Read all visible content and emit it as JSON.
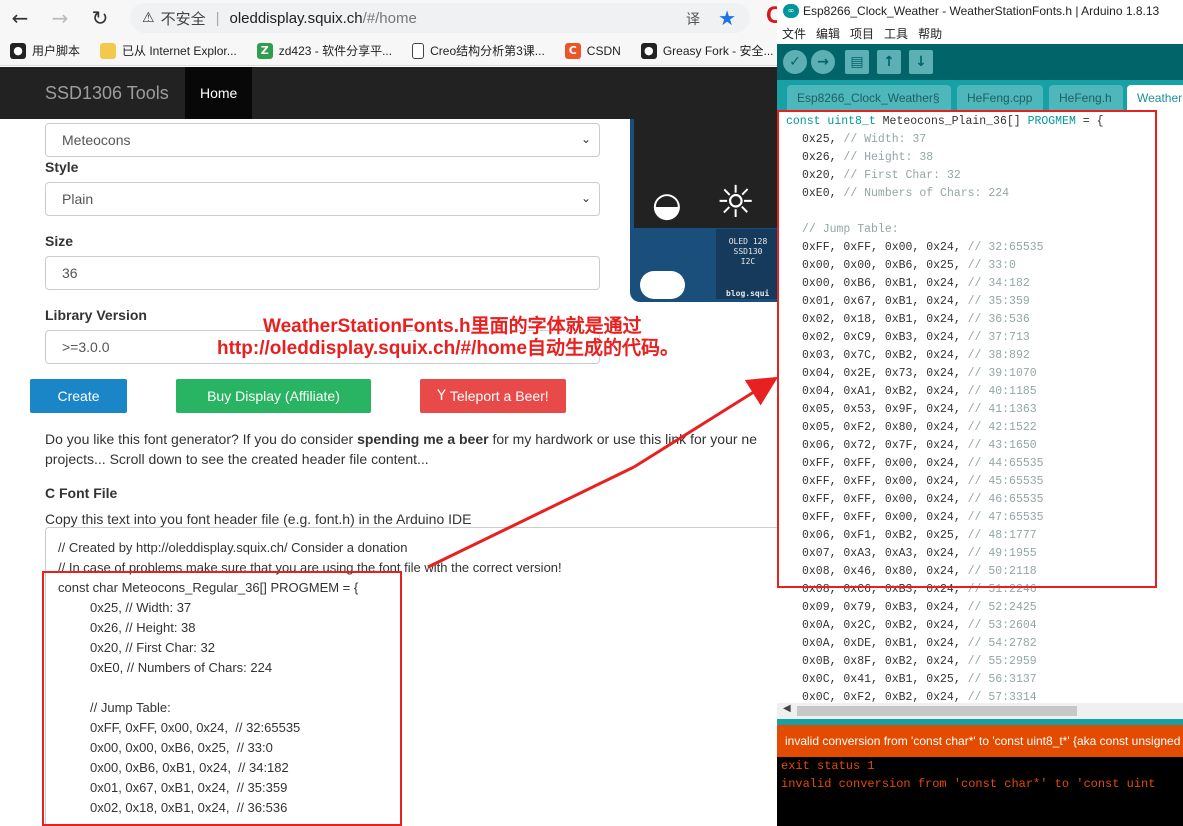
{
  "browser": {
    "security_label": "不安全",
    "url_host": "oleddisplay.squix.ch",
    "url_path": "/#/home",
    "bookmarks": [
      {
        "label": "用户脚本"
      },
      {
        "label": "已从 Internet Explor..."
      },
      {
        "label": "zd423 - 软件分享平..."
      },
      {
        "label": "Creo结构分析第3课..."
      },
      {
        "label": "CSDN"
      },
      {
        "label": "Greasy Fork - 安全..."
      }
    ]
  },
  "site": {
    "brand": "SSD1306 Tools",
    "nav_home": "Home",
    "font_family_value": "Meteocons",
    "style_label": "Style",
    "style_value": "Plain",
    "size_label": "Size",
    "size_value": "36",
    "library_label": "Library Version",
    "library_value": ">=3.0.0",
    "preview": {
      "chip_lines": [
        "OLED 128",
        "SSD130",
        "I2C"
      ],
      "chip_blog": "blog.squi"
    },
    "buttons": {
      "create": "Create",
      "buy": "Buy Display (Affiliate)",
      "beer": "Teleport a Beer!"
    },
    "para_line1_pre": "Do you like this font generator? If you do consider ",
    "para_line1_bold": "spending me a beer",
    "para_line1_post": " for my hardwork or use this link for your ne",
    "para_line2": "projects... Scroll down to see the created header file content...",
    "section_title": "C Font File",
    "copy_text": "Copy this text into you font header file (e.g. font.h) in the Arduino IDE",
    "code_lines": [
      {
        "text": "// Created by http://oleddisplay.squix.ch/ Consider a donation",
        "indent": false
      },
      {
        "text": "// In case of problems make sure that you are using the font file with the correct version!",
        "indent": false
      },
      {
        "text": "const char Meteocons_Regular_36[] PROGMEM = {",
        "indent": false
      },
      {
        "text": "0x25, // Width: 37",
        "indent": true
      },
      {
        "text": "0x26, // Height: 38",
        "indent": true
      },
      {
        "text": "0x20, // First Char: 32",
        "indent": true
      },
      {
        "text": "0xE0, // Numbers of Chars: 224",
        "indent": true
      },
      {
        "text": "",
        "indent": true
      },
      {
        "text": "// Jump Table:",
        "indent": true
      },
      {
        "text": "0xFF, 0xFF, 0x00, 0x24,  // 32:65535",
        "indent": true
      },
      {
        "text": "0x00, 0x00, 0xB6, 0x25,  // 33:0",
        "indent": true
      },
      {
        "text": "0x00, 0xB6, 0xB1, 0x24,  // 34:182",
        "indent": true
      },
      {
        "text": "0x01, 0x67, 0xB1, 0x24,  // 35:359",
        "indent": true
      },
      {
        "text": "0x02, 0x18, 0xB1, 0x24,  // 36:536",
        "indent": true
      }
    ]
  },
  "ide": {
    "title": "Esp8266_Clock_Weather - WeatherStationFonts.h | Arduino 1.8.13",
    "menu": [
      "文件",
      "编辑",
      "项目",
      "工具",
      "帮助"
    ],
    "tabs": [
      "Esp8266_Clock_Weather§",
      "HeFeng.cpp",
      "HeFeng.h",
      "Weather"
    ],
    "decl_kw1": "const",
    "decl_kw2": "uint8_t",
    "decl_name": " Meteocons_Plain_36[] ",
    "decl_kw3": "PROGMEM",
    "decl_end": " = {",
    "header_lines": [
      {
        "code": "0x25,",
        "comment": "// Width: 37"
      },
      {
        "code": "0x26,",
        "comment": "// Height: 38"
      },
      {
        "code": "0x20,",
        "comment": "// First Char: 32"
      },
      {
        "code": "0xE0,",
        "comment": "// Numbers of Chars: 224"
      }
    ],
    "jump_comment": "// Jump Table:",
    "jump_lines": [
      {
        "code": "0xFF, 0xFF, 0x00, 0x24,",
        "comment": "// 32:65535"
      },
      {
        "code": "0x00, 0x00, 0xB6, 0x25,",
        "comment": "// 33:0"
      },
      {
        "code": "0x00, 0xB6, 0xB1, 0x24,",
        "comment": "// 34:182"
      },
      {
        "code": "0x01, 0x67, 0xB1, 0x24,",
        "comment": "// 35:359"
      },
      {
        "code": "0x02, 0x18, 0xB1, 0x24,",
        "comment": "// 36:536"
      },
      {
        "code": "0x02, 0xC9, 0xB3, 0x24,",
        "comment": "// 37:713"
      },
      {
        "code": "0x03, 0x7C, 0xB2, 0x24,",
        "comment": "// 38:892"
      },
      {
        "code": "0x04, 0x2E, 0x73, 0x24,",
        "comment": "// 39:1070"
      },
      {
        "code": "0x04, 0xA1, 0xB2, 0x24,",
        "comment": "// 40:1185"
      },
      {
        "code": "0x05, 0x53, 0x9F, 0x24,",
        "comment": "// 41:1363"
      },
      {
        "code": "0x05, 0xF2, 0x80, 0x24,",
        "comment": "// 42:1522"
      },
      {
        "code": "0x06, 0x72, 0x7F, 0x24,",
        "comment": "// 43:1650"
      },
      {
        "code": "0xFF, 0xFF, 0x00, 0x24,",
        "comment": "// 44:65535"
      },
      {
        "code": "0xFF, 0xFF, 0x00, 0x24,",
        "comment": "// 45:65535"
      },
      {
        "code": "0xFF, 0xFF, 0x00, 0x24,",
        "comment": "// 46:65535"
      },
      {
        "code": "0xFF, 0xFF, 0x00, 0x24,",
        "comment": "// 47:65535"
      },
      {
        "code": "0x06, 0xF1, 0xB2, 0x25,",
        "comment": "// 48:1777"
      },
      {
        "code": "0x07, 0xA3, 0xA3, 0x24,",
        "comment": "// 49:1955"
      },
      {
        "code": "0x08, 0x46, 0x80, 0x24,",
        "comment": "// 50:2118"
      },
      {
        "code": "0x08, 0xC6, 0xB3, 0x24,",
        "comment": "// 51:2246"
      },
      {
        "code": "0x09, 0x79, 0xB3, 0x24,",
        "comment": "// 52:2425"
      },
      {
        "code": "0x0A, 0x2C, 0xB2, 0x24,",
        "comment": "// 53:2604"
      },
      {
        "code": "0x0A, 0xDE, 0xB1, 0x24,",
        "comment": "// 54:2782"
      },
      {
        "code": "0x0B, 0x8F, 0xB2, 0x24,",
        "comment": "// 55:2959"
      },
      {
        "code": "0x0C, 0x41, 0xB1, 0x25,",
        "comment": "// 56:3137"
      },
      {
        "code": "0x0C, 0xF2, 0xB2, 0x24,",
        "comment": "// 57:3314"
      }
    ],
    "status": "invalid conversion from 'const char*' to 'const uint8_t*' {aka const unsigned",
    "console": [
      "exit status 1",
      "invalid conversion from 'const char*' to 'const uint"
    ]
  },
  "annotation": {
    "line1": "WeatherStationFonts.h里面的字体就是通过",
    "line2": "http://oleddisplay.squix.ch/#/home自动生成的代码。"
  },
  "colors": {
    "accent_red": "#e8201f",
    "arduino_teal": "#00979c",
    "navbar": "#222222"
  }
}
